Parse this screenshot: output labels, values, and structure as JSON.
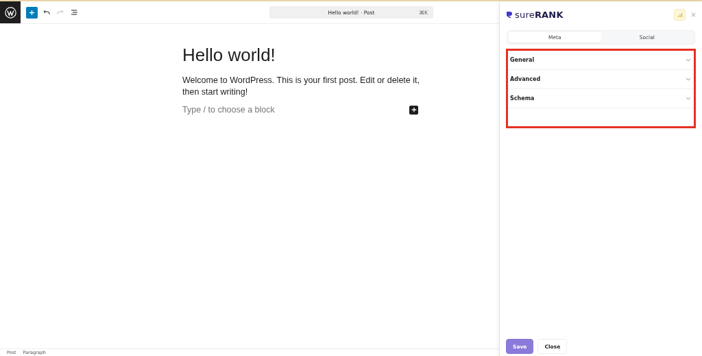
{
  "toolbar": {
    "document_title": "Hello world! · Post",
    "shortcut": "⌘K",
    "redo_disabled": true
  },
  "post": {
    "title": "Hello world!",
    "paragraph": "Welcome to WordPress. This is your first post. Edit or delete it, then start writing!",
    "placeholder": "Type / to choose a block"
  },
  "breadcrumb": [
    "Post",
    "Paragraph"
  ],
  "sidebar": {
    "brand_light": "sure",
    "brand_bold": "RANK",
    "tabs": [
      {
        "label": "Meta",
        "selected": true
      },
      {
        "label": "Social",
        "selected": false
      }
    ],
    "sections": [
      {
        "label": "General",
        "expanded": false
      },
      {
        "label": "Advanced",
        "expanded": false
      },
      {
        "label": "Schema",
        "expanded": false
      }
    ],
    "buttons": [
      {
        "label": "Save",
        "kind": "primary"
      },
      {
        "label": "Close",
        "kind": "secondary"
      }
    ]
  }
}
